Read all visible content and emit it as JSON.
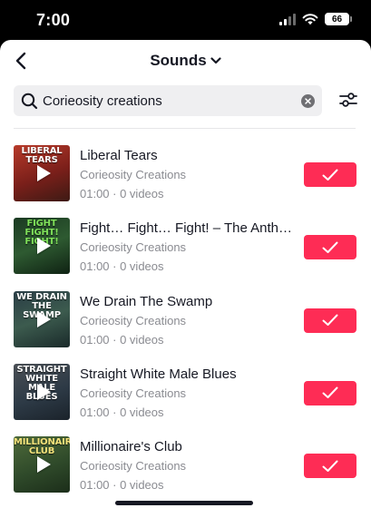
{
  "status_bar": {
    "time": "7:00",
    "battery": "66"
  },
  "header": {
    "title": "Sounds",
    "back_icon": "chevron-left-icon",
    "dropdown_icon": "chevron-down-icon"
  },
  "search": {
    "value": "Corieosity creations",
    "placeholder": "",
    "icon": "search-icon",
    "clear_icon": "clear-icon",
    "filter_icon": "filter-sliders-icon"
  },
  "colors": {
    "accent": "#fe2c55",
    "text_primary": "#161823",
    "text_secondary": "#8a8b91",
    "search_bg": "#efeff1"
  },
  "tracks": [
    {
      "title": "Liberal Tears",
      "artist": "Corieosity Creations",
      "meta": "01:00 · 0 videos",
      "thumb_text": "LIBERAL TEARS",
      "thumb_bg": "linear-gradient(160deg,#b73a2a 0%,#7a1f1a 55%,#3d1a14 100%)",
      "thumb_text_color": "#ffffff",
      "selected": true
    },
    {
      "title": "Fight… Fight… Fight! – The Anthe…",
      "artist": "Corieosity Creations",
      "meta": "01:00 · 0 videos",
      "thumb_text": "FIGHT FIGHT! FIGHT!",
      "thumb_bg": "linear-gradient(160deg,#1b3a22 0%,#2e5a31 50%,#0f2213 100%)",
      "thumb_text_color": "#7fe05a",
      "selected": true
    },
    {
      "title": "We Drain The Swamp",
      "artist": "Corieosity Creations",
      "meta": "01:00 · 0 videos",
      "thumb_text": "WE DRAIN THE SWAMP",
      "thumb_bg": "linear-gradient(160deg,#2a3d46 0%,#3c5b4e 50%,#1a2a2a 100%)",
      "thumb_text_color": "#ffffff",
      "selected": true
    },
    {
      "title": "Straight White Male Blues",
      "artist": "Corieosity Creations",
      "meta": "01:00 · 0 videos",
      "thumb_text": "STRAIGHT WHITE MALE BLUES",
      "thumb_bg": "linear-gradient(160deg,#4a4f55 0%,#2d3a46 55%,#1b232b 100%)",
      "thumb_text_color": "#ffffff",
      "selected": true
    },
    {
      "title": "Millionaire's Club",
      "artist": "Corieosity Creations",
      "meta": "01:00 · 0 videos",
      "thumb_text": "MILLIONAIRE'S CLUB",
      "thumb_bg": "linear-gradient(160deg,#4e6a3a 0%,#2f4a2a 55%,#1c2e1a 100%)",
      "thumb_text_color": "#f3e27a",
      "selected": true
    }
  ]
}
